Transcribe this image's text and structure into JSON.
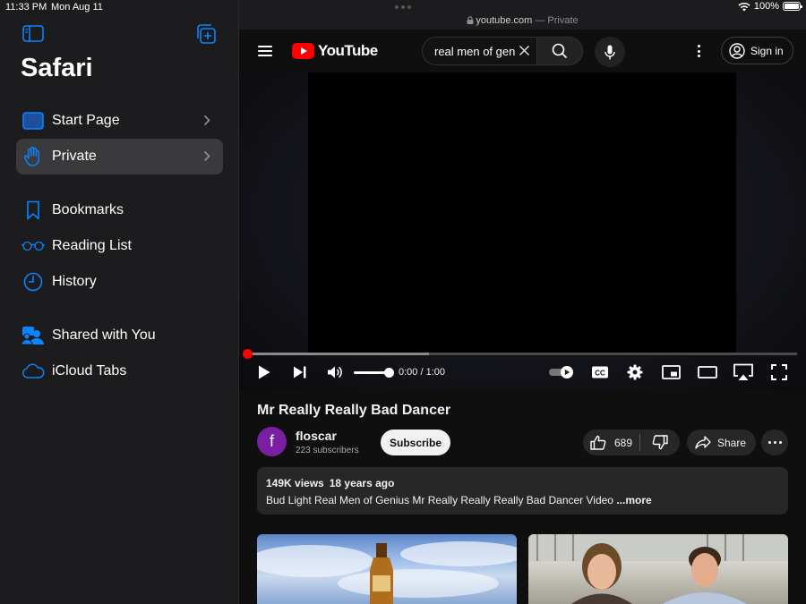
{
  "status_bar": {
    "time": "11:33 PM",
    "date": "Mon Aug 11",
    "battery": "100%",
    "battery_level": 1.0
  },
  "sidebar": {
    "title": "Safari",
    "items": [
      {
        "label": "Start Page",
        "icon": "start-page-icon",
        "active": false
      },
      {
        "label": "Private",
        "icon": "hand-icon",
        "active": true
      },
      {
        "label": "Bookmarks",
        "icon": "bookmark-icon"
      },
      {
        "label": "Reading List",
        "icon": "glasses-icon"
      },
      {
        "label": "History",
        "icon": "clock-icon"
      },
      {
        "label": "Shared with You",
        "icon": "shared-people-icon"
      },
      {
        "label": "iCloud Tabs",
        "icon": "cloud-icon"
      }
    ]
  },
  "url_bar": {
    "host": "youtube.com",
    "mode": " — Private"
  },
  "youtube": {
    "logo_text": "YouTube",
    "search_value": "real men of gen",
    "sign_in": "Sign in"
  },
  "player": {
    "time": "0:00 / 1:00",
    "progress": 0.0,
    "buffered": 0.33,
    "volume": 1.0
  },
  "video": {
    "title": "Mr Really Really Bad Dancer",
    "channel_initial": "f",
    "channel_name": "floscar",
    "subscribers": "223 subscribers",
    "subscribe_label": "Subscribe",
    "likes": "689",
    "share_label": "Share",
    "views": "149K views",
    "age": "18 years ago",
    "description": "Bud Light Real Men of Genius Mr Really Really Really Bad Dancer Video ",
    "more_label": "...more"
  },
  "colors": {
    "accent_blue": "#0a84ff",
    "youtube_red": "#ff0000",
    "channel_avatar": "#7b1fa2"
  }
}
